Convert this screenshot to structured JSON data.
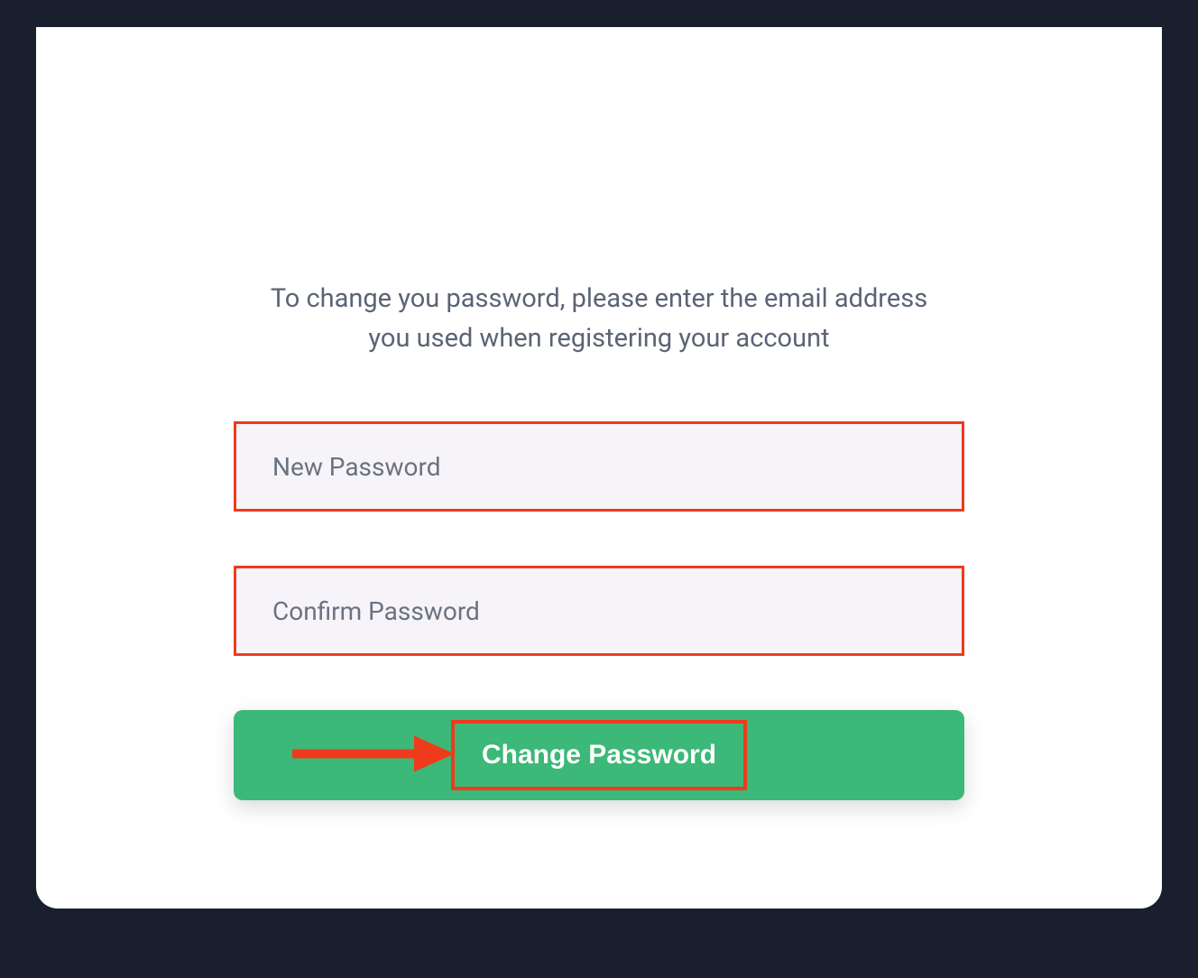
{
  "instruction": "To change you password, please enter the email address you used when registering your account",
  "fields": {
    "new_password": {
      "placeholder": "New Password",
      "value": ""
    },
    "confirm_password": {
      "placeholder": "Confirm Password",
      "value": ""
    }
  },
  "button": {
    "label": "Change Password"
  },
  "colors": {
    "highlight": "#ef3b1c",
    "primary_button": "#3cb878",
    "background_dark": "#1a1f2e",
    "input_bg": "#f6f4f8"
  }
}
